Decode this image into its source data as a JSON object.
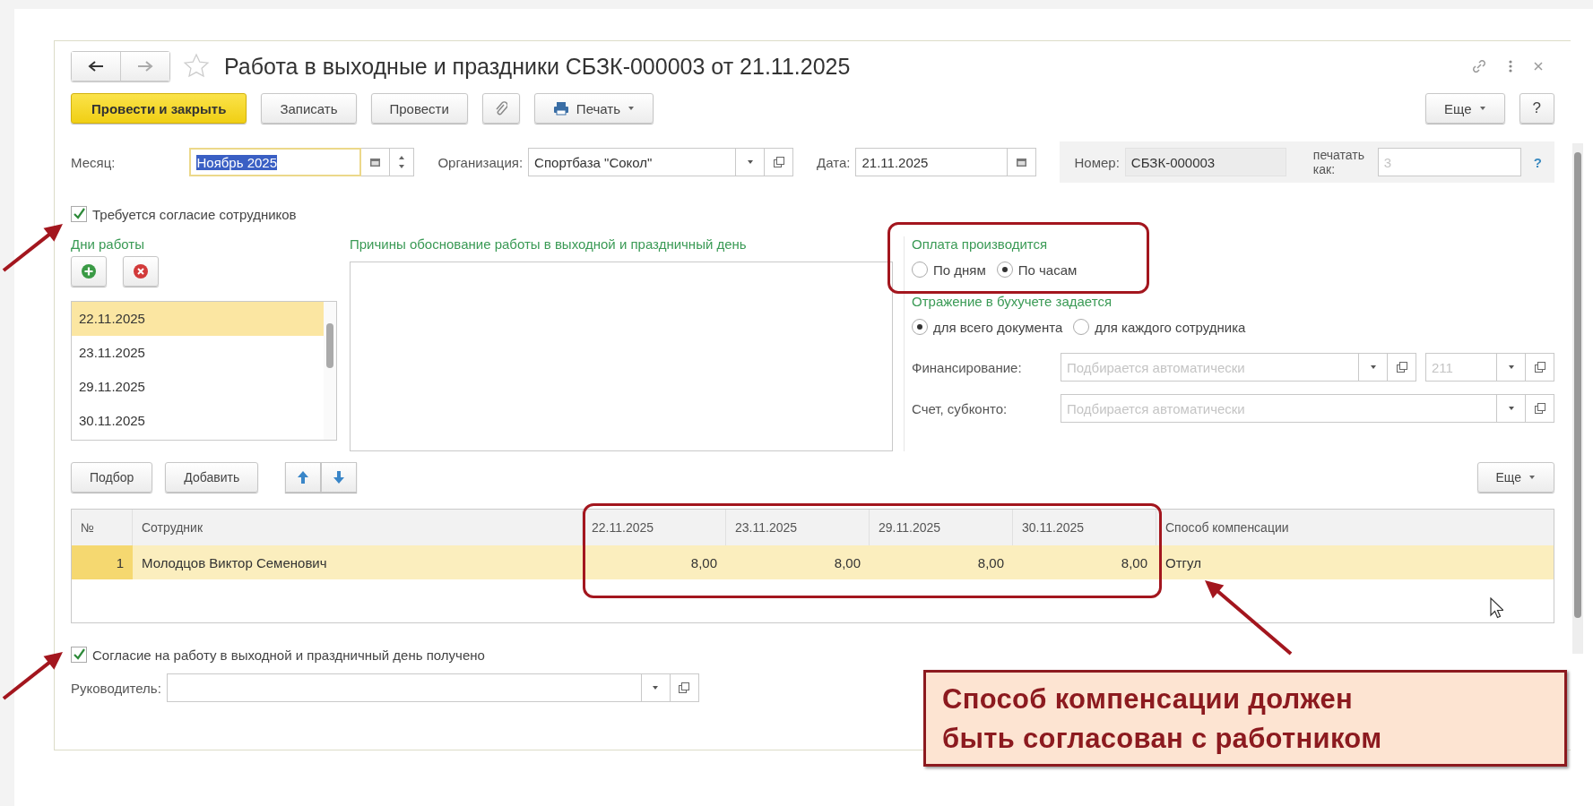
{
  "window": {
    "title": "Работа в выходные и праздники СБЗК-000003 от 21.11.2025"
  },
  "toolbar": {
    "buttons": [
      {
        "kind": "primary",
        "label": "Провести и закрыть"
      },
      {
        "kind": "plain",
        "label": "Записать"
      },
      {
        "kind": "plain",
        "label": "Провести"
      },
      {
        "kind": "attach"
      },
      {
        "kind": "menu",
        "label": "Печать"
      }
    ],
    "more": "Еще",
    "help": "?"
  },
  "header": {
    "month": {
      "label": "Месяц:",
      "value": "Ноябрь 2025",
      "text_selected": true
    },
    "organization": {
      "label": "Организация:",
      "value": "Спортбаза \"Сокол\""
    },
    "date": {
      "label": "Дата:",
      "value": "21.11.2025"
    },
    "number": {
      "label": "Номер:",
      "value": "СБЗК-000003"
    },
    "print_as": {
      "label": "печатать как:",
      "placeholder": "3"
    },
    "help": "?"
  },
  "consent_required": {
    "label": "Требуется согласие сотрудников",
    "checked": true
  },
  "work_days": {
    "title": "Дни работы",
    "items": [
      {
        "text": "22.11.2025",
        "selected": true
      },
      {
        "text": "23.11.2025",
        "selected": false
      },
      {
        "text": "29.11.2025",
        "selected": false
      },
      {
        "text": "30.11.2025",
        "selected": false
      }
    ]
  },
  "reasons": {
    "title": "Причины обоснование работы в выходной и праздничный день"
  },
  "payment": {
    "title": "Оплата производится",
    "options": [
      {
        "label": "По дням",
        "selected": false
      },
      {
        "label": "По часам",
        "selected": true
      }
    ]
  },
  "accounting": {
    "title": "Отражение в бухучете задается",
    "options": [
      {
        "label": "для всего документа",
        "selected": true
      },
      {
        "label": "для каждого сотрудника",
        "selected": false
      }
    ],
    "financing": {
      "label": "Финансирование:",
      "placeholder": "Подбирается автоматически",
      "code_placeholder": "211"
    },
    "account": {
      "label": "Счет, субконто:",
      "placeholder": "Подбирается автоматически"
    }
  },
  "table_toolbar": {
    "buttons": [
      "Подбор",
      "Добавить"
    ],
    "more": "Еще"
  },
  "table": {
    "columns": [
      {
        "label": "№",
        "kind": "index"
      },
      {
        "label": "Сотрудник",
        "kind": "text"
      },
      {
        "label": "22.11.2025",
        "kind": "number"
      },
      {
        "label": "23.11.2025",
        "kind": "number"
      },
      {
        "label": "29.11.2025",
        "kind": "number"
      },
      {
        "label": "30.11.2025",
        "kind": "number"
      },
      {
        "label": "Способ компенсации",
        "kind": "text"
      }
    ],
    "rows": [
      {
        "selected": true,
        "cells": [
          "1",
          "Молодцов Виктор Семенович",
          "8,00",
          "8,00",
          "8,00",
          "8,00",
          "Отгул"
        ]
      }
    ]
  },
  "consent_received": {
    "label": "Согласие на работу в выходной и праздничный день получено",
    "checked": true
  },
  "manager": {
    "label": "Руководитель:"
  },
  "callout": {
    "text": "Способ компенсации должен\nбыть согласован с работником"
  }
}
